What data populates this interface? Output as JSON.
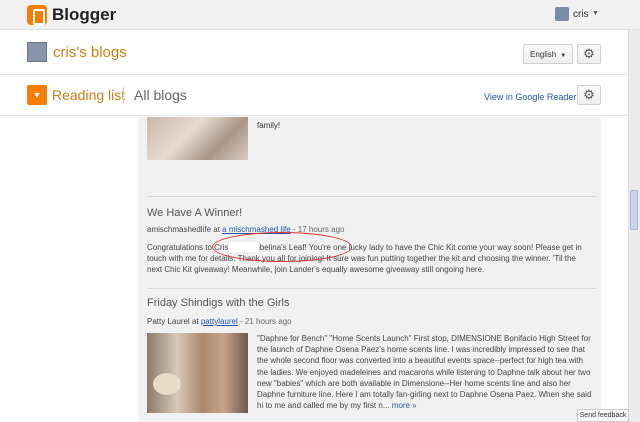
{
  "topbar": {
    "brand": "Blogger",
    "account_name": "cris"
  },
  "blog_header": {
    "title": "cris's blogs",
    "language": "English"
  },
  "reading_header": {
    "reading_list_label": "Reading list",
    "all_blogs_label": "All blogs",
    "google_reader_link": "View in Google Reader"
  },
  "posts": [
    {
      "excerpt_tail": "family!"
    },
    {
      "title": "We Have A Winner!",
      "blog_name": "amischmashedlife",
      "at": "at",
      "author_link": "a mischmashed life",
      "time": "- 17 hours ago",
      "excerpt": "Congratulations to Cris of Thumbelina's Leaf! You're one lucky lady to have the Chic Kit come your way soon! Please get in touch with me for details. Thank you all for joining! It sure was fun putting together the kit and choosing the winner. 'Til the next Chic Kit giveaway! Meanwhile, join Lander's equally awesome giveaway still ongoing here."
    },
    {
      "title": "Friday Shindigs with the Girls",
      "blog_name": "Patty Laurel",
      "at": "at",
      "author_link": "pattylaurel",
      "time": "- 21 hours ago",
      "excerpt": "\"Daphne for Bench\" \"Home Scents Launch\" First stop, DIMENSIONE Bonifacio High Street for the launch of Daphne Osena Paez's home scents line. I was incredibly impressed to see that the whole second floor was converted into a beautiful events space--perfect for high tea with the ladies. We enjoyed madeleines and macarons while listening to Daphne talk about her two new \"babies\" which are both available in Dimensione--Her home scents line and also her Daphne furniture line. Here I am totally fan-girling next to Daphne Osena Paez. When she said hi to me and called me by my first n...",
      "more_label": "more »"
    }
  ],
  "feedback_label": "Send feedback",
  "colors": {
    "accent": "#f57d00",
    "title_orange": "#c87e16",
    "link": "#2255aa"
  }
}
